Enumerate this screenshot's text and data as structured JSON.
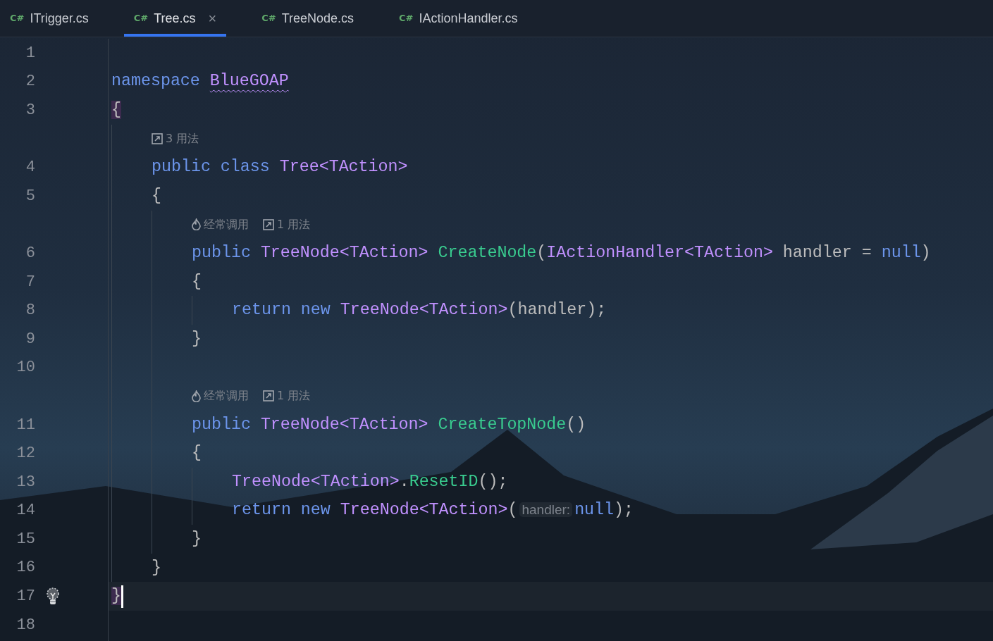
{
  "tabs": [
    {
      "lang": "C#",
      "label": "ITrigger.cs",
      "selected": false
    },
    {
      "lang": "C#",
      "label": "Tree.cs",
      "selected": true,
      "close": "×"
    },
    {
      "lang": "C#",
      "label": "TreeNode.cs",
      "selected": false
    },
    {
      "lang": "C#",
      "label": "IActionHandler.cs",
      "selected": false
    }
  ],
  "lines": [
    {
      "kind": "code",
      "number": "1",
      "current": false
    },
    {
      "kind": "code",
      "number": "2",
      "current": false,
      "tokens": [
        {
          "text": "namespace ",
          "kind": "keyword"
        },
        {
          "text": "BlueGOAP",
          "kind": "type-warning"
        }
      ]
    },
    {
      "kind": "code",
      "number": "3",
      "current": false,
      "tokens": [
        {
          "text": "{",
          "kind": "brace-match"
        }
      ],
      "children": [
        {
          "kind": "hint",
          "items": [
            {
              "kind": "usages",
              "text": "3 用法"
            }
          ]
        },
        {
          "kind": "code",
          "number": "4",
          "current": false,
          "tokens": [
            {
              "text": "public class ",
              "kind": "keyword"
            },
            {
              "text": "Tree<TAction>",
              "kind": "type"
            }
          ]
        },
        {
          "kind": "code",
          "number": "5",
          "current": false,
          "tokens": [
            {
              "text": "{",
              "kind": "plain"
            }
          ],
          "children": [
            {
              "kind": "hint",
              "items": [
                {
                  "kind": "fire",
                  "text": "经常调用"
                },
                {
                  "kind": "usages",
                  "text": "1 用法"
                }
              ]
            },
            {
              "kind": "code",
              "number": "6",
              "current": false,
              "tokens": [
                {
                  "text": "public ",
                  "kind": "keyword"
                },
                {
                  "text": "TreeNode<TAction> ",
                  "kind": "type"
                },
                {
                  "text": "CreateNode",
                  "kind": "method"
                },
                {
                  "text": "(",
                  "kind": "plain"
                },
                {
                  "text": "IActionHandler<TAction>",
                  "kind": "type"
                },
                {
                  "text": " handler = ",
                  "kind": "plain"
                },
                {
                  "text": "null",
                  "kind": "keyword"
                },
                {
                  "text": ")",
                  "kind": "plain"
                }
              ]
            },
            {
              "kind": "code",
              "number": "7",
              "current": false,
              "tokens": [
                {
                  "text": "{",
                  "kind": "plain"
                }
              ],
              "children": [
                {
                  "kind": "code",
                  "number": "8",
                  "current": false,
                  "tokens": [
                    {
                      "text": "return new ",
                      "kind": "keyword"
                    },
                    {
                      "text": "TreeNode<TAction>",
                      "kind": "type"
                    },
                    {
                      "text": "(handler);",
                      "kind": "plain"
                    }
                  ]
                }
              ]
            },
            {
              "kind": "code",
              "number": "9",
              "current": false,
              "tokens": [
                {
                  "text": "}",
                  "kind": "plain"
                }
              ]
            },
            {
              "kind": "code",
              "number": "10",
              "current": false
            },
            {
              "kind": "hint",
              "items": [
                {
                  "kind": "fire",
                  "text": "经常调用"
                },
                {
                  "kind": "usages",
                  "text": "1 用法"
                }
              ]
            },
            {
              "kind": "code",
              "number": "11",
              "current": false,
              "tokens": [
                {
                  "text": "public ",
                  "kind": "keyword"
                },
                {
                  "text": "TreeNode<TAction> ",
                  "kind": "type"
                },
                {
                  "text": "CreateTopNode",
                  "kind": "method"
                },
                {
                  "text": "()",
                  "kind": "plain"
                }
              ]
            },
            {
              "kind": "code",
              "number": "12",
              "current": false,
              "tokens": [
                {
                  "text": "{",
                  "kind": "plain"
                }
              ],
              "children": [
                {
                  "kind": "code",
                  "number": "13",
                  "current": false,
                  "tokens": [
                    {
                      "text": "TreeNode<TAction>",
                      "kind": "type"
                    },
                    {
                      "text": ".",
                      "kind": "plain"
                    },
                    {
                      "text": "ResetID",
                      "kind": "method"
                    },
                    {
                      "text": "();",
                      "kind": "plain"
                    }
                  ]
                },
                {
                  "kind": "code",
                  "number": "14",
                  "current": false,
                  "tokens": [
                    {
                      "text": "return new ",
                      "kind": "keyword"
                    },
                    {
                      "text": "TreeNode<TAction>",
                      "kind": "type"
                    },
                    {
                      "text": "(",
                      "kind": "plain"
                    },
                    {
                      "text": "handler:",
                      "kind": "param-hint"
                    },
                    {
                      "text": "null",
                      "kind": "keyword"
                    },
                    {
                      "text": ");",
                      "kind": "plain"
                    }
                  ]
                }
              ]
            },
            {
              "kind": "code",
              "number": "15",
              "current": false,
              "tokens": [
                {
                  "text": "}",
                  "kind": "plain"
                }
              ]
            }
          ]
        },
        {
          "kind": "code",
          "number": "16",
          "current": false,
          "tokens": [
            {
              "text": "}",
              "kind": "plain"
            }
          ]
        }
      ]
    },
    {
      "kind": "code",
      "number": "17",
      "current": true,
      "tokens": [
        {
          "text": "}",
          "kind": "brace-match"
        }
      ]
    },
    {
      "kind": "code",
      "number": "18",
      "current": false
    }
  ]
}
